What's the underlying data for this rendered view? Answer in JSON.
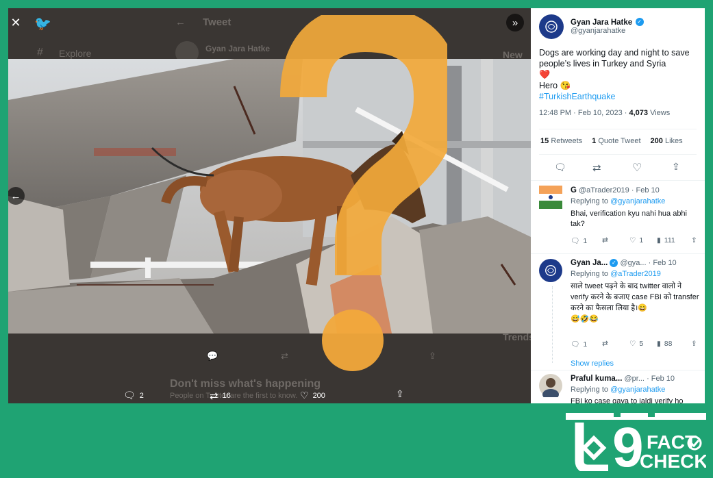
{
  "background_tweet": {
    "header_title": "Tweet",
    "nav_explore": "Explore",
    "author_name": "Gyan Jara Hatke",
    "right_new": "New",
    "right_trends": "Trends",
    "signup_title": "Don't miss what's happening",
    "signup_sub": "People on Twitter are the first to know."
  },
  "lightbox": {
    "close_icon": "close-icon",
    "expand_icon": "chevrons-right-icon",
    "prev_icon": "arrow-left-icon",
    "stats": {
      "replies": "2",
      "retweets": "16",
      "likes": "200"
    }
  },
  "tweet": {
    "author_name": "Gyan Jara Hatke",
    "author_handle": "@gyanjarahatke",
    "text_line1": "Dogs are working day and night to save people’s lives in Turkey and Syria",
    "heart": "❤️",
    "text_line2": "Hero 😘",
    "hashtag": "#TurkishEarthquake",
    "timestamp": "12:48 PM · Feb 10, 2023 · ",
    "views_count": "4,073",
    "views_label": "Views",
    "retweets_count": "15",
    "retweets_label": "Retweets",
    "quote_count": "1",
    "quote_label": "Quote Tweet",
    "likes_count": "200",
    "likes_label": "Likes"
  },
  "replies": [
    {
      "name": "G",
      "handle": "@aTrader2019",
      "date": "· Feb 10",
      "replying_to_label": "Replying to",
      "replying_to": "@gyanjarahatke",
      "text": "Bhai, verification kyu nahi hua abhi tak?",
      "stats": {
        "replies": "1",
        "retweets": "",
        "likes": "1",
        "views": "111"
      }
    },
    {
      "name": "Gyan Ja...",
      "handle": "@gya...",
      "date": "· Feb 10",
      "replying_to_label": "Replying to",
      "replying_to": "@aTrader2019",
      "text": "साले tweet पढ़ने के बाद twitter वालो ने verify करने के बजाए case FBI को transfer करने का फैसला लिया है।😄",
      "emoji": "😅🤣😂",
      "stats": {
        "replies": "1",
        "retweets": "",
        "likes": "5",
        "views": "88"
      },
      "show_replies": "Show replies"
    },
    {
      "name": "Praful kuma...",
      "handle": "@pr...",
      "date": "· Feb 10",
      "replying_to_label": "Replying to",
      "replying_to": "@gyanjarahatke",
      "text": "FBI ko case gaya to jaldi verify ho"
    }
  ],
  "watermark": {
    "line1": "FACT",
    "line2": "CHECK",
    "number": "9"
  },
  "colors": {
    "frame_green": "#1fa373",
    "twitter_blue": "#1d9bf0",
    "question_mark": "#f2a93b",
    "heart_red": "#e0245e"
  }
}
